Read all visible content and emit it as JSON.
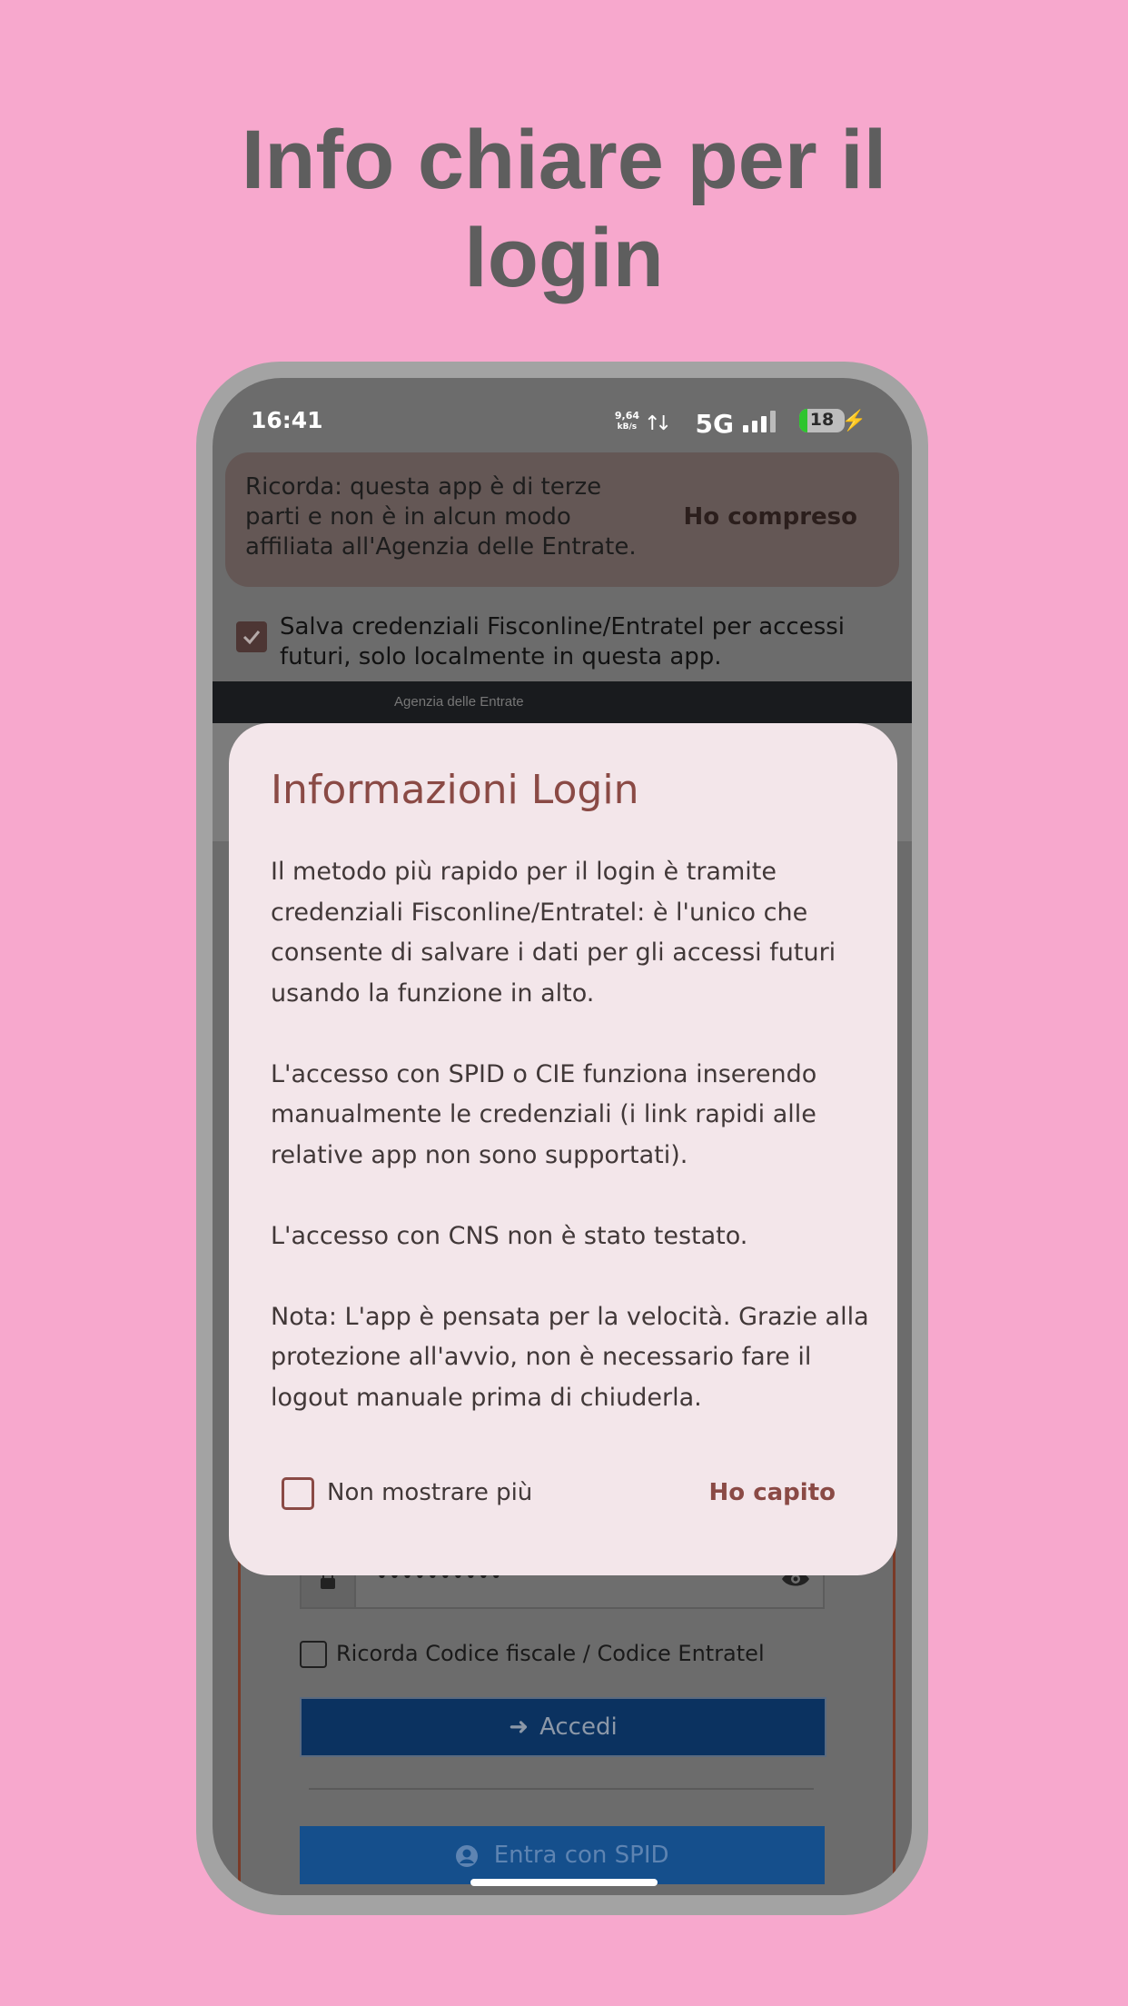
{
  "headline": {
    "line1": "Info chiare per il",
    "line2": "login"
  },
  "status_bar": {
    "time": "16:41",
    "speed_value": "9,64",
    "speed_unit": "kB/s",
    "network": "5G",
    "battery": "18",
    "battery_level": 0.18
  },
  "disclaimer": {
    "text": "Ricorda: questa app è di terze parti e non è in alcun modo affiliata all'Agenzia delle Entrate.",
    "button": "Ho compreso"
  },
  "save_credentials": {
    "label": "Salva credenziali Fisconline/Entratel per accessi futuri, solo localmente in questa app.",
    "checked": true
  },
  "webview": {
    "header": "Agenzia delle Entrate"
  },
  "login_form": {
    "password_value": "••••••••••",
    "remember_label": "Ricorda Codice fiscale / Codice Entratel",
    "accedi_button": "Accedi",
    "spid_button": "Entra con SPID"
  },
  "dialog": {
    "title": "Informazioni Login",
    "paragraphs": [
      "Il metodo più rapido per il login è tramite credenziali Fisconline/Entratel: è l'unico che consente di salvare i dati per gli accessi futuri usando la funzione in alto.",
      "L'accesso con SPID o CIE funziona inserendo manualmente le credenziali (i link rapidi alle relative app non sono supportati).",
      "L'accesso con CNS non è stato testato.",
      "Nota: L'app è pensata per la velocità. Grazie alla protezione all'avvio, non è necessario fare il logout manuale prima di chiuderla."
    ],
    "checkbox_label": "Non mostrare più",
    "ok_button": "Ho capito"
  },
  "colors": {
    "background": "#f7a8cd",
    "accent": "#8a4a45",
    "dialog_bg": "#f3e6ea",
    "primary_button": "#0b3260"
  }
}
